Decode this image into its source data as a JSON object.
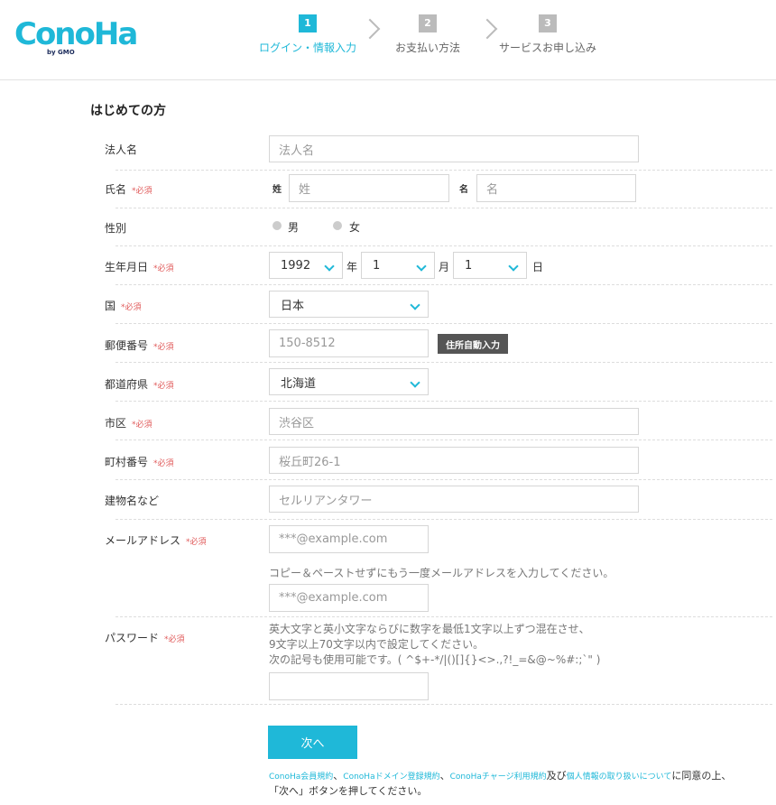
{
  "header": {
    "logo": "ConoHa",
    "logo_sub": "by GMO",
    "steps": [
      {
        "num": "1",
        "label": "ログイン・情報入力"
      },
      {
        "num": "2",
        "label": "お支払い方法"
      },
      {
        "num": "3",
        "label": "サービスお申し込み"
      }
    ]
  },
  "form": {
    "section_title": "はじめての方",
    "required_mark": "*必須",
    "corporate": {
      "label": "法人名",
      "placeholder": "法人名"
    },
    "name": {
      "label": "氏名",
      "last_label": "姓",
      "last_placeholder": "姓",
      "first_label": "名",
      "first_placeholder": "名"
    },
    "gender": {
      "label": "性別",
      "male": "男",
      "female": "女"
    },
    "birth": {
      "label": "生年月日",
      "year": "1992",
      "year_unit": "年",
      "month": "1",
      "month_unit": "月",
      "day": "1",
      "day_unit": "日"
    },
    "country": {
      "label": "国",
      "value": "日本"
    },
    "zip": {
      "label": "郵便番号",
      "placeholder": "150-8512",
      "autofill_button": "住所自動入力"
    },
    "prefecture": {
      "label": "都道府県",
      "value": "北海道"
    },
    "city": {
      "label": "市区",
      "placeholder": "渋谷区"
    },
    "town": {
      "label": "町村番号",
      "placeholder": "桜丘町26-1"
    },
    "building": {
      "label": "建物名など",
      "placeholder": "セルリアンタワー"
    },
    "email": {
      "label": "メールアドレス",
      "placeholder": "***@example.com",
      "confirm_hint": "コピー＆ペーストせずにもう一度メールアドレスを入力してください。",
      "confirm_placeholder": "***@example.com"
    },
    "password": {
      "label": "パスワード",
      "hint1": "英大文字と英小文字ならびに数字を最低1文字以上ずつ混在させ、",
      "hint2": "9文字以上70文字以内で設定してください。",
      "hint3": "次の記号も使用可能です。( ^$+-*/|()[]{}<>.,?!_=&@~%#:;`\" )"
    },
    "next_button": "次へ",
    "terms": {
      "link1": "ConoHa会員規約",
      "sep1": "、",
      "link2": "ConoHaドメイン登録規約",
      "sep2": "、",
      "link3": "ConoHaチャージ利用規約",
      "and": "及び",
      "link4": "個人情報の取り扱いについて",
      "agree": "に同意の上、",
      "line2": "「次へ」ボタンを押してください。"
    }
  },
  "colors": {
    "accent": "#1fb8d8",
    "required": "#e05a5a",
    "dark_button": "#555555"
  }
}
